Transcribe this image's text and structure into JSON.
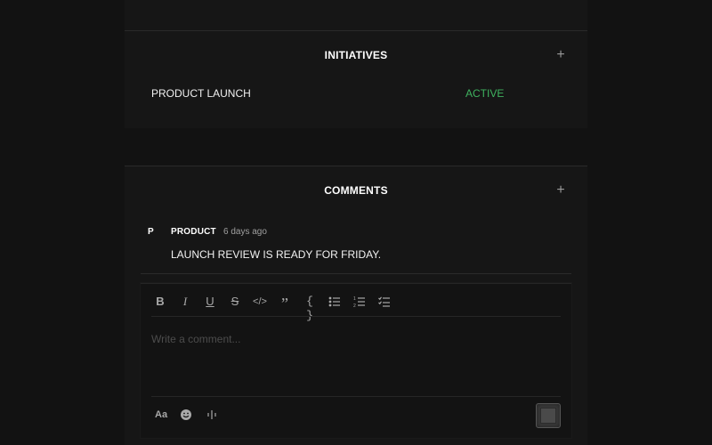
{
  "initiatives": {
    "title": "INITIATIVES",
    "add_label": "+",
    "items": [
      {
        "name": "PRODUCT LAUNCH",
        "status": "ACTIVE"
      }
    ]
  },
  "comments": {
    "title": "COMMENTS",
    "add_label": "+",
    "items": [
      {
        "avatar": "P",
        "author": "PRODUCT",
        "time": "6 days ago",
        "body": "LAUNCH REVIEW IS READY FOR FRIDAY."
      }
    ]
  },
  "editor": {
    "toolbar": [
      {
        "name": "bold",
        "icon": "bold-icon"
      },
      {
        "name": "italic",
        "icon": "italic-icon"
      },
      {
        "name": "underline",
        "icon": "underline-icon"
      },
      {
        "name": "strikethrough",
        "icon": "strikethrough-icon"
      },
      {
        "name": "inline-code",
        "icon": "code-icon"
      },
      {
        "name": "quote",
        "icon": "quote-icon"
      },
      {
        "name": "code-block",
        "icon": "code-block-icon"
      },
      {
        "name": "bullet-list",
        "icon": "bullet-list-icon"
      },
      {
        "name": "numbered-list",
        "icon": "numbered-list-icon"
      },
      {
        "name": "task-list",
        "icon": "task-list-icon"
      }
    ],
    "placeholder": "Write a comment...",
    "format_label": "Aa",
    "emoji_icon": "emoji-icon",
    "voice_icon": "waveform-icon",
    "send_icon": "send-button"
  },
  "colors": {
    "background": "#121212",
    "card": "#161616",
    "status_active": "#3fb25f"
  }
}
